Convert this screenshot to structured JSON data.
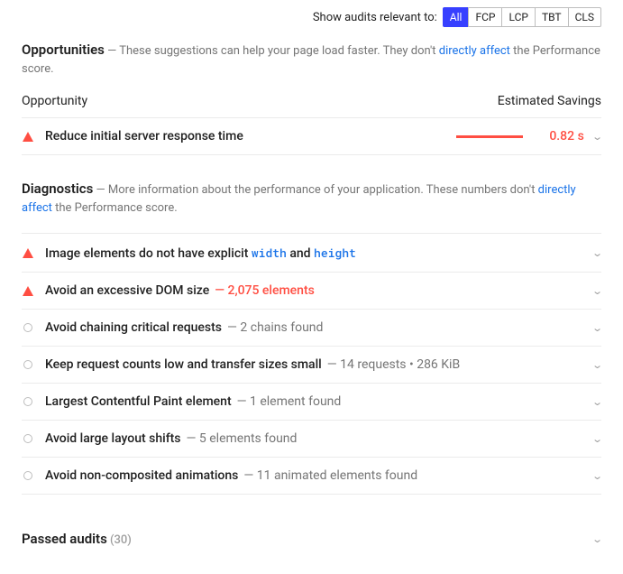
{
  "filter": {
    "label": "Show audits relevant to:",
    "options": [
      "All",
      "FCP",
      "LCP",
      "TBT",
      "CLS"
    ],
    "active": "All"
  },
  "opportunities": {
    "title": "Opportunities",
    "desc_prefix": "— These suggestions can help your page load faster. They don't ",
    "desc_link": "directly affect",
    "desc_suffix": " the Performance score.",
    "col_left": "Opportunity",
    "col_right": "Estimated Savings",
    "items": [
      {
        "severity": "fail",
        "title": "Reduce initial server response time",
        "savings": "0.82 s"
      }
    ]
  },
  "diagnostics": {
    "title": "Diagnostics",
    "desc_prefix": "— More information about the performance of your application. These numbers don't ",
    "desc_link": "directly affect",
    "desc_suffix": " the Performance score.",
    "items": [
      {
        "severity": "fail",
        "title_a": "Image elements do not have explicit ",
        "code_a": "width",
        "mid": " and ",
        "code_b": "height"
      },
      {
        "severity": "fail",
        "title": "Avoid an excessive DOM size",
        "detail": "— 2,075 elements",
        "detail_red": true
      },
      {
        "severity": "neutral",
        "title": "Avoid chaining critical requests",
        "detail": "— 2 chains found"
      },
      {
        "severity": "neutral",
        "title": "Keep request counts low and transfer sizes small",
        "detail": "— 14 requests • 286 KiB"
      },
      {
        "severity": "neutral",
        "title": "Largest Contentful Paint element",
        "detail": "— 1 element found"
      },
      {
        "severity": "neutral",
        "title": "Avoid large layout shifts",
        "detail": "— 5 elements found"
      },
      {
        "severity": "neutral",
        "title": "Avoid non-composited animations",
        "detail": "— 11 animated elements found"
      }
    ]
  },
  "passed": {
    "title": "Passed audits",
    "count": "(30)"
  }
}
